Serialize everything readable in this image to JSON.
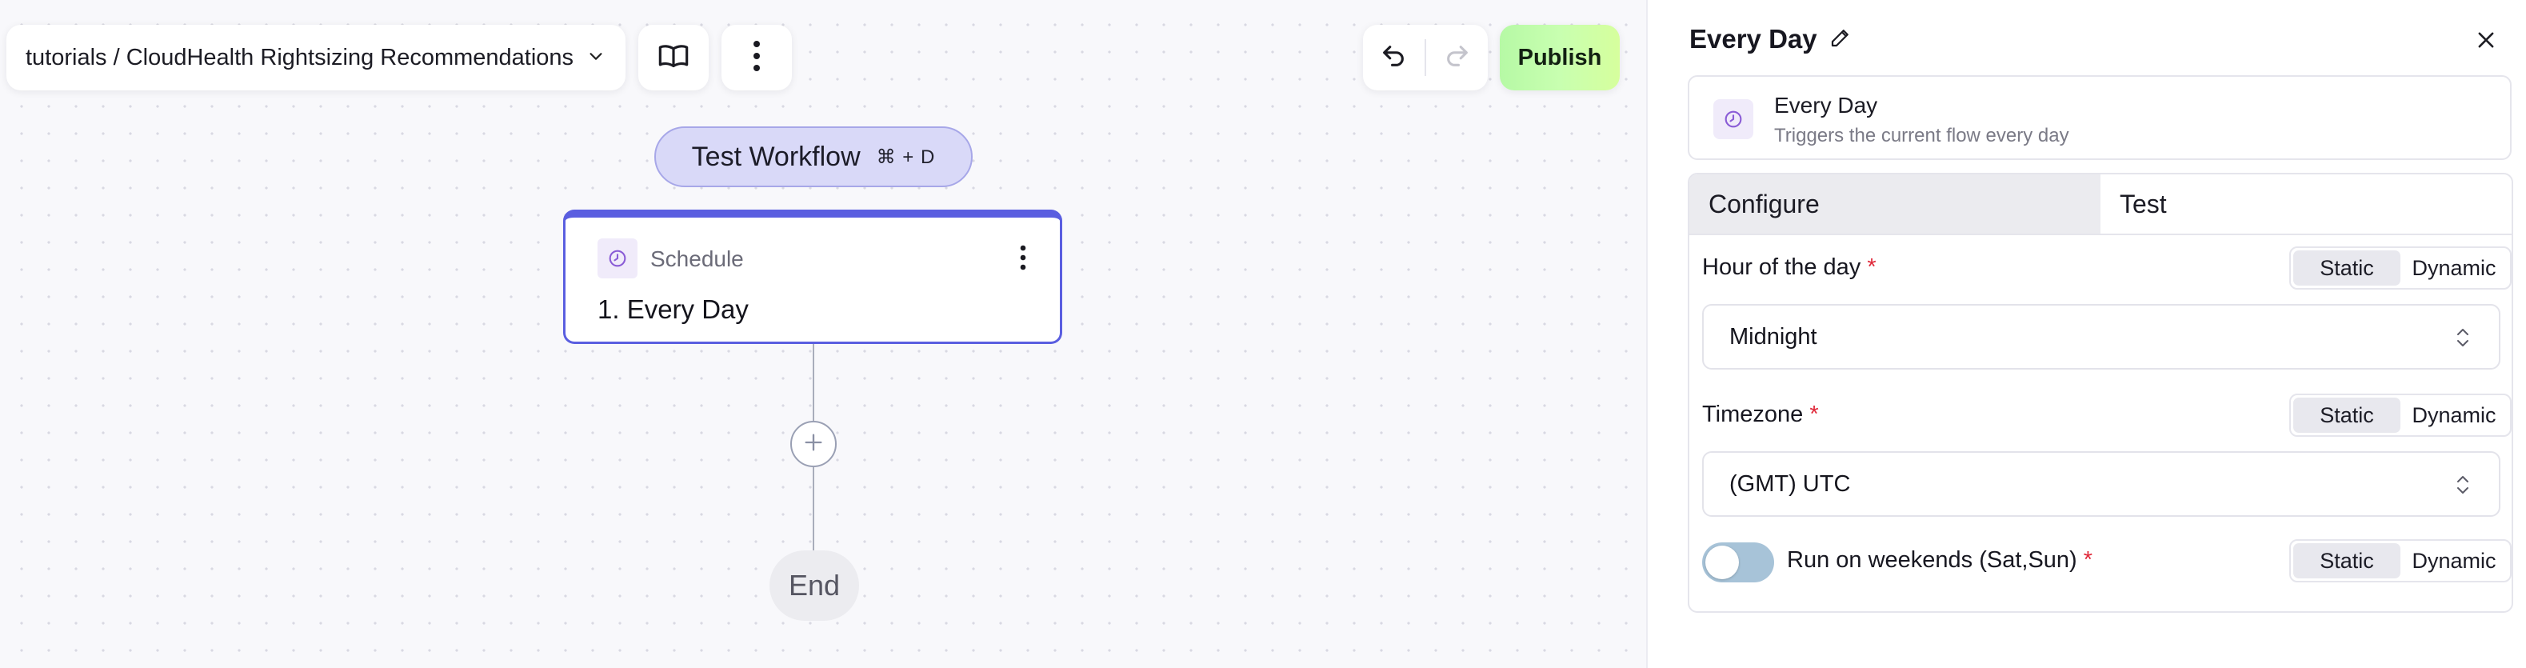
{
  "toolbar": {
    "breadcrumb": "tutorials / CloudHealth Rightsizing Recommendations",
    "publish_label": "Publish"
  },
  "canvas": {
    "test_workflow_label": "Test Workflow",
    "test_workflow_shortcut": "⌘ + D",
    "step": {
      "category": "Schedule",
      "title": "1. Every Day"
    },
    "end_label": "End"
  },
  "panel": {
    "title": "Every Day",
    "trigger": {
      "name": "Every Day",
      "description": "Triggers the current flow every day"
    },
    "tabs": [
      "Configure",
      "Test"
    ],
    "fields": {
      "hour": {
        "label": "Hour of the day",
        "required": "*",
        "value": "Midnight"
      },
      "timezone": {
        "label": "Timezone",
        "required": "*",
        "value": "(GMT) UTC"
      },
      "weekends": {
        "label": "Run on weekends (Sat,Sun)",
        "required": "*",
        "enabled": false
      }
    },
    "mode_options": [
      "Static",
      "Dynamic"
    ]
  },
  "colors": {
    "accent": "#5a5ee0",
    "publish_gradient_start": "#b6f9a5",
    "test_workflow_bg": "#d9d9f8",
    "required": "#e0293a",
    "toggle_off": "#a7c3d8"
  },
  "icons": [
    "chevron-down-icon",
    "book-icon",
    "kebab-icon",
    "undo-icon",
    "redo-icon",
    "schedule-icon",
    "plus-icon",
    "pencil-icon",
    "close-icon",
    "select-chevron-icon"
  ]
}
